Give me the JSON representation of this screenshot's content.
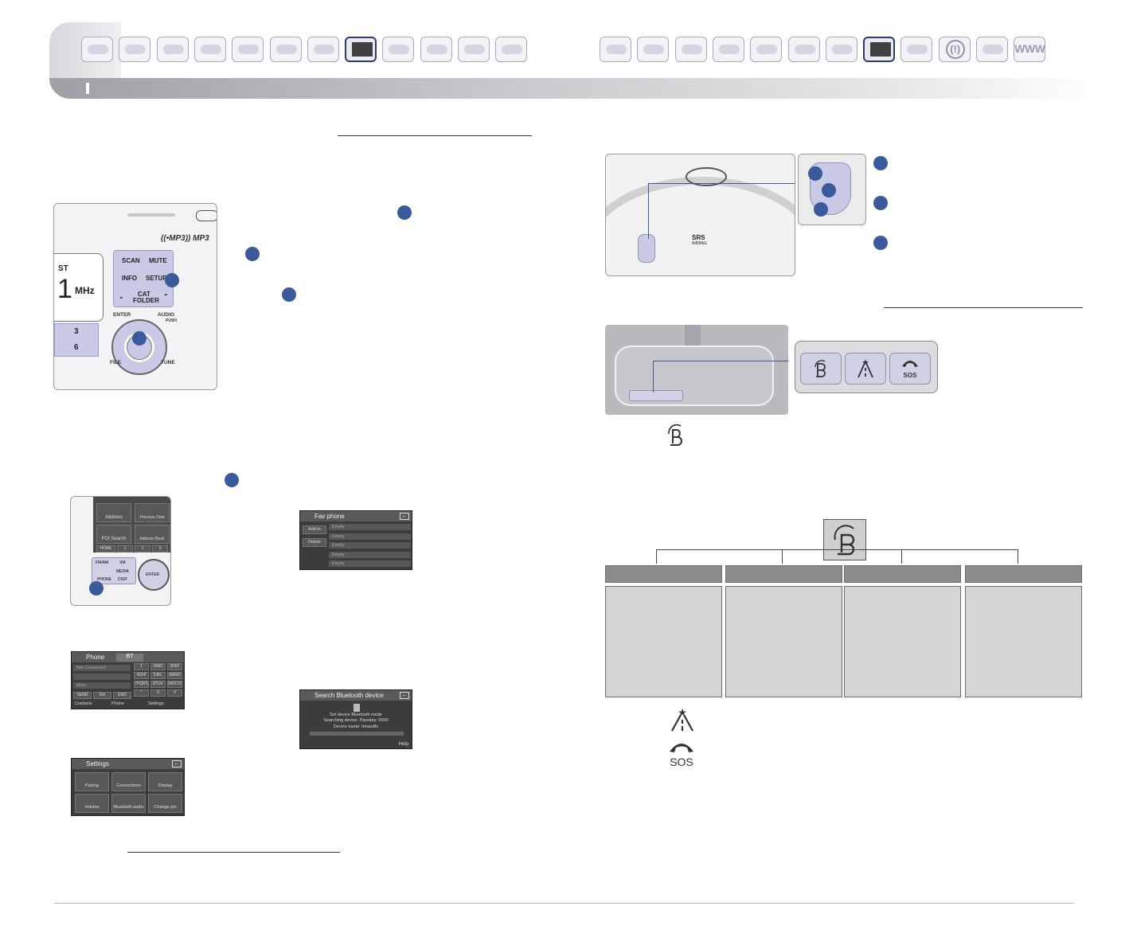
{
  "header": {
    "left_thumbnails": [
      "thumb-1",
      "thumb-2",
      "thumb-3",
      "thumb-4",
      "thumb-5",
      "thumb-6",
      "thumb-7",
      "thumb-8-selected",
      "thumb-9",
      "thumb-10",
      "thumb-11",
      "thumb-12"
    ],
    "right_thumbnails": [
      "thumb-1",
      "thumb-2",
      "thumb-3",
      "thumb-4",
      "thumb-5",
      "thumb-6",
      "thumb-7",
      "thumb-8-selected",
      "thumb-9",
      "thumb-10",
      "thumb-11",
      "thumb-12"
    ],
    "www_label": "WWW",
    "warning_label": "(!)"
  },
  "radio_panel": {
    "mp3_logo": "((•MP3)) MP3",
    "st_label": "ST",
    "frequency": "1",
    "unit": "MHz",
    "scan_label": "SCAN",
    "mute_label": "MUTE",
    "info_label": "INFO",
    "setup_label": "SETUP",
    "cat_label": "CAT",
    "folder_label": "FOLDER",
    "enter_label": "ENTER",
    "audio_label": "AUDIO",
    "push_label": "PUSH",
    "file_label": "FILE",
    "tune_label": "TUNE",
    "preset_3": "3",
    "preset_6": "6"
  },
  "nav_panel": {
    "address": "Address",
    "previous_dest": "Previous Dest",
    "poi_search": "POI Search",
    "address_book": "Address Book",
    "home": "HOME",
    "k1": "1",
    "k2": "2",
    "k3": "3",
    "fm_am": "FM/AM",
    "xm": "XM",
    "media": "MEDIA",
    "phone": "PHONE",
    "disp": "DISP",
    "enter": "ENTER"
  },
  "fav_phone": {
    "title": "Fav phone",
    "left_buttons": [
      "Add to",
      "Delete"
    ],
    "rows": [
      "Empty",
      "Empty",
      "Empty",
      "Empty",
      "Empty"
    ]
  },
  "phone_screen": {
    "title": "Phone",
    "tab": "BT",
    "status": "Not Connected",
    "timer": "timer",
    "keys": [
      "1",
      "2ABC",
      "3DEF",
      "4GHI",
      "5JKL",
      "6MNO",
      "7PQRS",
      "8TUV",
      "9WXYZ",
      "*",
      "0",
      "#"
    ],
    "bottom_left": [
      "SEND",
      "Del",
      "END"
    ],
    "footer": [
      "Contacts",
      "Phone",
      "Settings"
    ]
  },
  "search_screen": {
    "title": "Search Bluetooth device",
    "message_1": "Set device Bluetooth mode",
    "message_2": "Searching device. Passkey: 0000",
    "message_3": "Device name: hmasdfs",
    "help": "Help"
  },
  "settings_screen": {
    "title": "Settings",
    "items": [
      "Pairing",
      "Connections",
      "Display",
      "Volume",
      "Bluetooth audio",
      "Change pin"
    ]
  },
  "wheel_panel": {
    "srs": "SRS",
    "airbag": "AIRBAG"
  },
  "mirror_zoom": {
    "sos": "SOS"
  },
  "icons": {
    "sos_text": "SOS"
  },
  "colors": {
    "accent_blue": "#3a5a9c",
    "header_gray": "#9fa0a6",
    "table_head": "#8b8b8e",
    "table_body": "#d5d5d7"
  }
}
